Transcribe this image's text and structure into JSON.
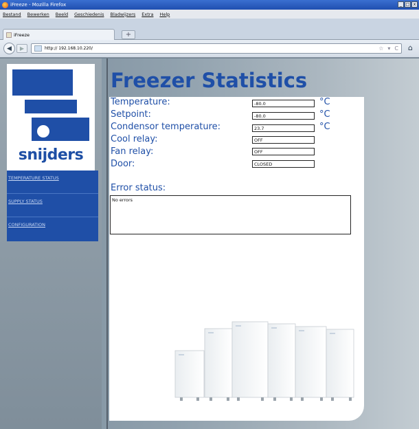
{
  "window": {
    "title": "iFreeze - Mozilla Firefox",
    "btn_min": "_",
    "btn_max": "□",
    "btn_close": "x"
  },
  "menu": [
    "Bestand",
    "Bewerken",
    "Beeld",
    "Geschiedenis",
    "Bladwijzers",
    "Extra",
    "Help"
  ],
  "tab": {
    "label": "iFreeze",
    "new_tab": "+"
  },
  "nav": {
    "url": "http:// 192.168.10.220/",
    "back": "◀",
    "forward": "▶",
    "star": "☆",
    "dropdown": "▾",
    "reload": "C",
    "home": "⌂"
  },
  "logo": {
    "text": "snijders"
  },
  "sidebar": {
    "items": [
      {
        "label": "TEMPERATURE STATUS"
      },
      {
        "label": "SUPPLY STATUS"
      },
      {
        "label": "CONFIGURATION"
      }
    ]
  },
  "page": {
    "title": "Freezer Statistics",
    "fields": [
      {
        "label": "Temperature:",
        "value": "-80.0",
        "unit": "°C"
      },
      {
        "label": "Setpoint:",
        "value": "-80.0",
        "unit": "°C"
      },
      {
        "label": "Condensor temperature:",
        "value": "23.7",
        "unit": "°C"
      },
      {
        "label": "Cool relay:",
        "value": "OFF",
        "unit": ""
      },
      {
        "label": "Fan relay:",
        "value": "OFF",
        "unit": ""
      },
      {
        "label": "Door:",
        "value": "CLOSED",
        "unit": ""
      }
    ],
    "error_label": "Error status:",
    "error_text": "No errors"
  },
  "colors": {
    "brand_blue": "#1f4fa7",
    "sidebar_nav": "#1f4fa7"
  }
}
